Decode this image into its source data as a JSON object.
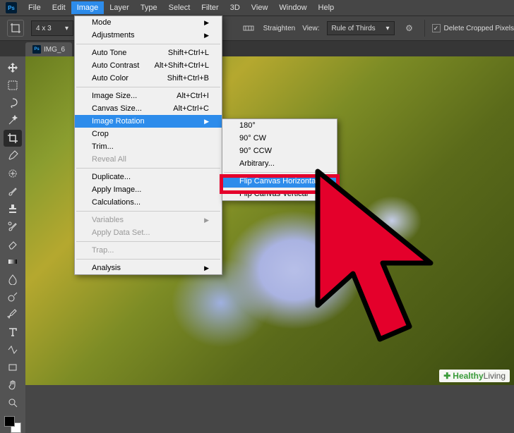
{
  "app": {
    "logo": "Ps"
  },
  "menubar": {
    "items": [
      "File",
      "Edit",
      "Image",
      "Layer",
      "Type",
      "Select",
      "Filter",
      "3D",
      "View",
      "Window",
      "Help"
    ],
    "active_index": 2
  },
  "optionsbar": {
    "ratio": "4 x 3",
    "straighten": "Straighten",
    "view_label": "View:",
    "view_value": "Rule of Thirds",
    "delete_cropped_label": "Delete Cropped Pixels",
    "delete_cropped_checked": true
  },
  "document": {
    "tab_label": "IMG_6"
  },
  "image_menu": {
    "items": [
      {
        "label": "Mode",
        "submenu": true
      },
      {
        "label": "Adjustments",
        "submenu": true
      },
      {
        "sep": true
      },
      {
        "label": "Auto Tone",
        "shortcut": "Shift+Ctrl+L"
      },
      {
        "label": "Auto Contrast",
        "shortcut": "Alt+Shift+Ctrl+L"
      },
      {
        "label": "Auto Color",
        "shortcut": "Shift+Ctrl+B"
      },
      {
        "sep": true
      },
      {
        "label": "Image Size...",
        "shortcut": "Alt+Ctrl+I"
      },
      {
        "label": "Canvas Size...",
        "shortcut": "Alt+Ctrl+C"
      },
      {
        "label": "Image Rotation",
        "submenu": true,
        "hover": true
      },
      {
        "label": "Crop"
      },
      {
        "label": "Trim..."
      },
      {
        "label": "Reveal All",
        "disabled": true
      },
      {
        "sep": true
      },
      {
        "label": "Duplicate..."
      },
      {
        "label": "Apply Image..."
      },
      {
        "label": "Calculations..."
      },
      {
        "sep": true
      },
      {
        "label": "Variables",
        "submenu": true,
        "disabled": true
      },
      {
        "label": "Apply Data Set...",
        "disabled": true
      },
      {
        "sep": true
      },
      {
        "label": "Trap...",
        "disabled": true
      },
      {
        "sep": true
      },
      {
        "label": "Analysis",
        "submenu": true
      }
    ]
  },
  "rotation_submenu": {
    "items": [
      {
        "label": "180°"
      },
      {
        "label": "90° CW"
      },
      {
        "label": "90° CCW"
      },
      {
        "label": "Arbitrary..."
      },
      {
        "sep": true
      },
      {
        "label": "Flip Canvas Horizontal",
        "hover": true,
        "boxed": true
      },
      {
        "label": "Flip Canvas Vertical"
      }
    ]
  },
  "tools": [
    "move",
    "marquee",
    "lasso",
    "wand",
    "crop",
    "eyedropper",
    "heal",
    "brush",
    "stamp",
    "history",
    "eraser",
    "gradient",
    "blur",
    "dodge",
    "pen",
    "type",
    "path",
    "rect",
    "hand",
    "zoom"
  ],
  "watermark": {
    "plus": "✚",
    "brand1": "Healthy",
    "brand2": "Living"
  }
}
